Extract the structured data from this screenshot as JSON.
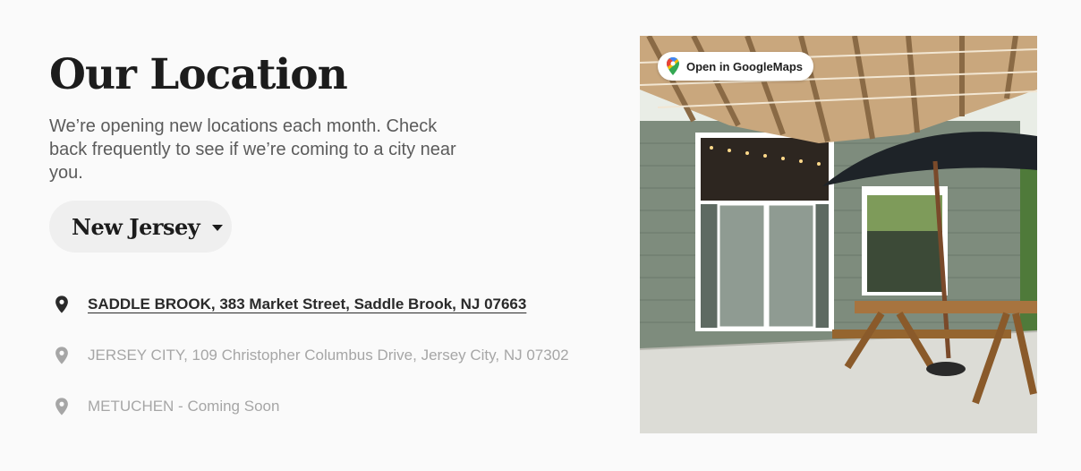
{
  "header": {
    "title": "Our Location",
    "intro": "We’re opening new locations each month. Check back frequently to see if we’re coming to a city near you."
  },
  "state_select": {
    "selected": "New Jersey",
    "icon": "caret-down-icon"
  },
  "locations": [
    {
      "label": "SADDLE BROOK, 383 Market Street, Saddle Brook, NJ 07663",
      "active": true
    },
    {
      "label": "JERSEY CITY, 109 Christopher Columbus Drive, Jersey City, NJ 07302",
      "active": false
    },
    {
      "label": "METUCHEN - Coming Soon",
      "active": false
    }
  ],
  "photo": {
    "maps_button_label": "Open in GoogleMaps",
    "maps_icon": "google-maps-pin-icon"
  },
  "colors": {
    "background": "#fafafa",
    "title": "#1c1c1c",
    "active_location": "#2a2a2a",
    "inactive_location": "#a6a6a6",
    "select_background": "#efefef"
  }
}
